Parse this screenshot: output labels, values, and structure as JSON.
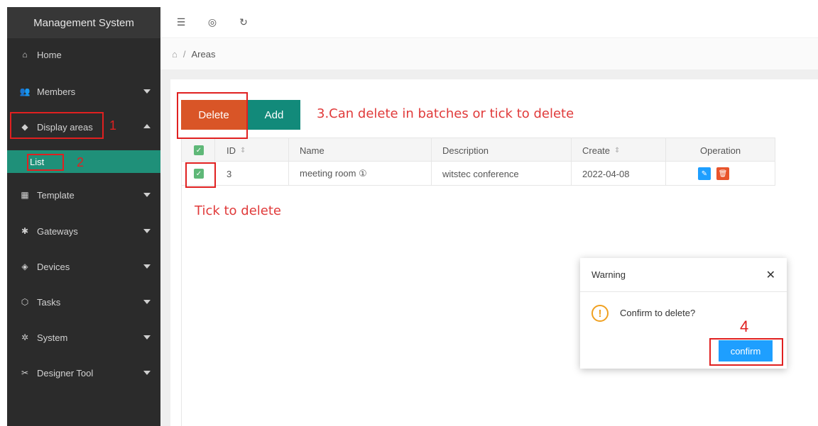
{
  "app": {
    "title": "Management System"
  },
  "sidebar": {
    "items": [
      {
        "label": "Home",
        "icon": "home-icon",
        "glyph": "⌂",
        "arrow": ""
      },
      {
        "label": "Members",
        "icon": "members-icon",
        "glyph": "👥",
        "arrow": "down"
      },
      {
        "label": "Display areas",
        "icon": "layers-icon",
        "glyph": "◆",
        "arrow": "up"
      },
      {
        "label": "Template",
        "icon": "template-icon",
        "glyph": "▦",
        "arrow": "down"
      },
      {
        "label": "Gateways",
        "icon": "gateway-icon",
        "glyph": "✱",
        "arrow": "down"
      },
      {
        "label": "Devices",
        "icon": "tag-icon",
        "glyph": "◈",
        "arrow": "down"
      },
      {
        "label": "Tasks",
        "icon": "cube-icon",
        "glyph": "⬡",
        "arrow": "down"
      },
      {
        "label": "System",
        "icon": "gear-icon",
        "glyph": "✲",
        "arrow": "down"
      },
      {
        "label": "Designer Tool",
        "icon": "tool-icon",
        "glyph": "✂",
        "arrow": "down"
      }
    ],
    "submenu": {
      "label": "List"
    }
  },
  "topbar": {
    "icons": [
      "menu-fold-icon",
      "globe-icon",
      "refresh-icon"
    ],
    "glyphs": [
      "☰",
      "◎",
      "↻"
    ]
  },
  "breadcrumb": {
    "home_glyph": "⌂",
    "separator": "/",
    "current": "Areas"
  },
  "toolbar": {
    "delete_label": "Delete",
    "add_label": "Add"
  },
  "table": {
    "columns": [
      "ID",
      "Name",
      "Description",
      "Create",
      "Operation"
    ],
    "rows": [
      {
        "id": "3",
        "name": "meeting room ①",
        "description": "witstec conference",
        "create": "2022-04-08"
      }
    ]
  },
  "annotations": {
    "n1": "1",
    "n2": "2",
    "step3": "3.Can delete in batches or tick to delete",
    "tick": "Tick to delete",
    "n4": "4"
  },
  "dialog": {
    "title": "Warning",
    "close_glyph": "✕",
    "message": "Confirm to delete?",
    "confirm_label": "confirm"
  },
  "colors": {
    "sidebar_bg": "#2b2b2b",
    "active_green": "#1f9079",
    "delete_red": "#d95527",
    "add_teal": "#128a7a",
    "confirm_blue": "#1e9fff",
    "annotation_red": "#e02020"
  }
}
